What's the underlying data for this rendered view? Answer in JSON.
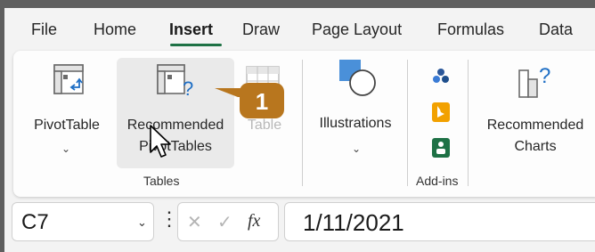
{
  "tabs": [
    {
      "label": "File"
    },
    {
      "label": "Home"
    },
    {
      "label": "Insert",
      "active": true
    },
    {
      "label": "Draw"
    },
    {
      "label": "Page Layout"
    },
    {
      "label": "Formulas"
    },
    {
      "label": "Data"
    }
  ],
  "ribbon": {
    "pivot_table": {
      "label": "PivotTable",
      "icon": "pivot-table-icon"
    },
    "recommended_pivot": {
      "label_line1": "Recommended",
      "label_line2": "PivotTables",
      "icon": "recommended-pivot-icon"
    },
    "table": {
      "label": "Table",
      "icon": "table-icon"
    },
    "tables_group_label": "Tables",
    "illustrations": {
      "label": "Illustrations",
      "icon": "shapes-icon"
    },
    "addins_group_label": "Add-ins",
    "recommended_charts": {
      "label_line1": "Recommended",
      "label_line2": "Charts",
      "icon": "recommended-charts-icon"
    }
  },
  "callout": {
    "number": "1"
  },
  "formula_bar": {
    "name_box": "C7",
    "cancel_symbol": "✕",
    "enter_symbol": "✓",
    "fx_symbol": "fx",
    "formula": "1/11/2021"
  },
  "colors": {
    "accent": "#1e7145",
    "callout": "#b8761e"
  }
}
